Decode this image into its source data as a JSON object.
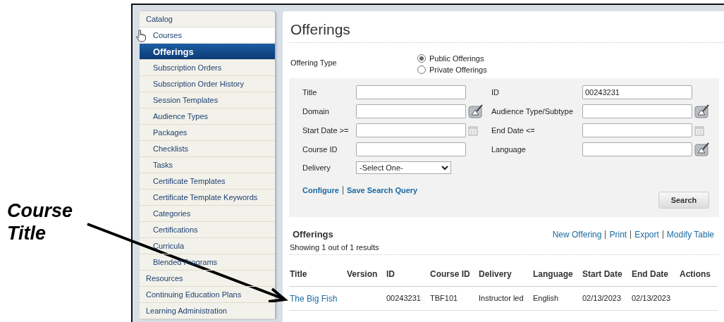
{
  "callout": {
    "text": "Course Title"
  },
  "sidebar": {
    "items": [
      {
        "label": "Catalog",
        "kind": "section",
        "selected": false,
        "hovered": false
      },
      {
        "label": "Courses",
        "kind": "child",
        "selected": false,
        "hovered": true
      },
      {
        "label": "Offerings",
        "kind": "child",
        "selected": true,
        "hovered": false
      },
      {
        "label": "Subscription Orders",
        "kind": "child",
        "selected": false,
        "hovered": false
      },
      {
        "label": "Subscription Order History",
        "kind": "child",
        "selected": false,
        "hovered": false
      },
      {
        "label": "Session Templates",
        "kind": "child",
        "selected": false,
        "hovered": false
      },
      {
        "label": "Audience Types",
        "kind": "child",
        "selected": false,
        "hovered": false
      },
      {
        "label": "Packages",
        "kind": "child",
        "selected": false,
        "hovered": false
      },
      {
        "label": "Checklists",
        "kind": "child",
        "selected": false,
        "hovered": false
      },
      {
        "label": "Tasks",
        "kind": "child",
        "selected": false,
        "hovered": false
      },
      {
        "label": "Certificate Templates",
        "kind": "child",
        "selected": false,
        "hovered": false
      },
      {
        "label": "Certificate Template Keywords",
        "kind": "child",
        "selected": false,
        "hovered": false
      },
      {
        "label": "Categories",
        "kind": "child",
        "selected": false,
        "hovered": false
      },
      {
        "label": "Certifications",
        "kind": "child",
        "selected": false,
        "hovered": false
      },
      {
        "label": "Curricula",
        "kind": "child",
        "selected": false,
        "hovered": false
      },
      {
        "label": "Blended Programs",
        "kind": "child",
        "selected": false,
        "hovered": false
      },
      {
        "label": "Resources",
        "kind": "section",
        "selected": false,
        "hovered": false
      },
      {
        "label": "Continuing Education Plans",
        "kind": "section",
        "selected": false,
        "hovered": false
      },
      {
        "label": "Learning Administration",
        "kind": "section",
        "selected": false,
        "hovered": false
      }
    ]
  },
  "page_title": "Offerings",
  "offering_type": {
    "label": "Offering Type",
    "options": [
      {
        "label": "Public Offerings",
        "selected": true
      },
      {
        "label": "Private Offerings",
        "selected": false
      }
    ]
  },
  "search_form": {
    "fields": [
      {
        "label": "Title",
        "kind": "text"
      },
      {
        "label": "ID",
        "kind": "text",
        "value": "00243231"
      },
      {
        "label": "Domain",
        "kind": "lookup"
      },
      {
        "label": "Audience Type/Subtype",
        "kind": "lookup"
      },
      {
        "label": "Start Date >=",
        "kind": "date"
      },
      {
        "label": "End Date <=",
        "kind": "date"
      },
      {
        "label": "Course ID",
        "kind": "text"
      },
      {
        "label": "Language",
        "kind": "lookup"
      },
      {
        "label": "Delivery",
        "kind": "select",
        "value": "-Select One-"
      }
    ],
    "links": [
      "Configure",
      "Save Search Query"
    ],
    "button": "Search"
  },
  "results": {
    "title": "Offerings",
    "actions": [
      "New Offering",
      "Print",
      "Export",
      "Modify Table"
    ],
    "summary": "Showing 1 out of 1 results",
    "columns": [
      "Title",
      "Version",
      "ID",
      "Course ID",
      "Delivery",
      "Language",
      "Start Date",
      "End Date",
      "Actions"
    ],
    "rows": [
      [
        "The Big Fish",
        "",
        "00243231",
        "TBF101",
        "Instructor led",
        "English",
        "02/13/2023",
        "02/13/2023",
        ""
      ]
    ]
  }
}
